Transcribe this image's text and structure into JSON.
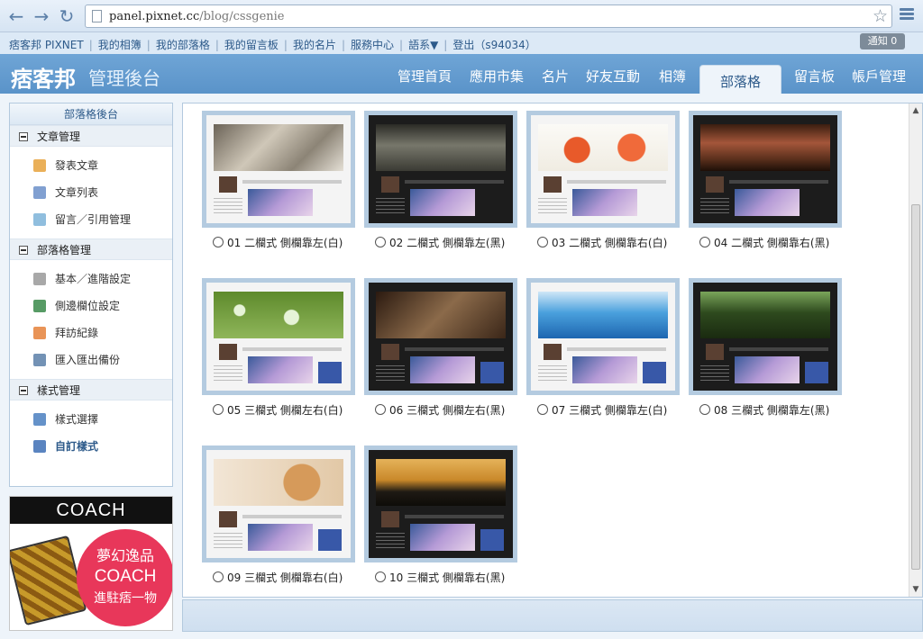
{
  "browser": {
    "url_host": "panel.pixnet.cc",
    "url_path": "/blog/cssgenie"
  },
  "toplinks": [
    "痞客邦 PIXNET",
    "我的相簿",
    "我的部落格",
    "我的留言板",
    "我的名片",
    "服務中心",
    "語系▼",
    "登出（s94034）"
  ],
  "notify": "通知 0",
  "header": {
    "logo": "痞客邦",
    "subtitle": "管理後台",
    "tabs": [
      "管理首頁",
      "應用市集",
      "名片",
      "好友互動",
      "相簿",
      "部落格",
      "留言板",
      "帳戶管理"
    ],
    "active_tab": "部落格"
  },
  "sidebar": {
    "title": "部落格後台",
    "sections": [
      {
        "label": "文章管理",
        "items": [
          "發表文章",
          "文章列表",
          "留言／引用管理"
        ]
      },
      {
        "label": "部落格管理",
        "items": [
          "基本／進階設定",
          "側邊欄位設定",
          "拜訪紀錄",
          "匯入匯出備份"
        ]
      },
      {
        "label": "樣式管理",
        "items": [
          "樣式選擇",
          "自訂樣式"
        ]
      }
    ]
  },
  "ad": {
    "brand": "COACH",
    "line1": "夢幻逸品",
    "line2": "COACH",
    "line3": "進駐痞一物"
  },
  "themes": [
    {
      "label": "01 二欄式 側欄靠左(白)",
      "style": "light",
      "banner": "photos"
    },
    {
      "label": "02 二欄式 側欄靠左(黑)",
      "style": "dark",
      "banner": "sea"
    },
    {
      "label": "03 二欄式 側欄靠右(白)",
      "style": "light",
      "banner": "food"
    },
    {
      "label": "04 二欄式 側欄靠右(黑)",
      "style": "dark",
      "banner": "street"
    },
    {
      "label": "05 三欄式 側欄左右(白)",
      "style": "light",
      "banner": "drops"
    },
    {
      "label": "06 三欄式 側欄左右(黑)",
      "style": "dark",
      "banner": "tree"
    },
    {
      "label": "07 三欄式 側欄靠左(白)",
      "style": "light",
      "banner": "ocean"
    },
    {
      "label": "08 三欄式 側欄靠左(黑)",
      "style": "dark",
      "banner": "park"
    },
    {
      "label": "09 三欄式 側欄靠右(白)",
      "style": "light",
      "banner": "cat"
    },
    {
      "label": "10 三欄式 側欄靠右(黑)",
      "style": "dark",
      "banner": "sunset"
    }
  ],
  "colors": {
    "header": "#5a93c9",
    "accent": "#2d5a8a",
    "card_frame": "#b4cbe0"
  }
}
